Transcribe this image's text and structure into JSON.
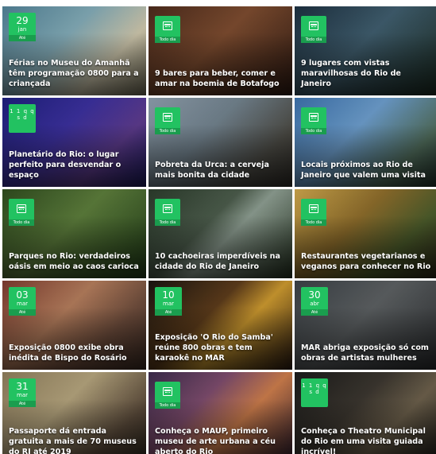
{
  "cards": [
    {
      "badge_type": "date",
      "day": "29",
      "month": "jan",
      "foot": "Até",
      "title": "Férias no Museu do Amanhã têm programação 0800 para a criançada",
      "bg": "linear-gradient(135deg,#4f7e93 0%,#7fa7b3 40%,#c9c2a8 70%,#6e6a55 100%)"
    },
    {
      "badge_type": "calendar",
      "foot": "Todo dia",
      "title": "9 bares para beber, comer e amar na boemia de Botafogo",
      "bg": "linear-gradient(135deg,#4a2a1c 0%,#7a4a2e 45%,#2e1a12 100%)"
    },
    {
      "badge_type": "calendar",
      "foot": "Todo dia",
      "title": "9 lugares com vistas maravilhosas do Rio de Janeiro",
      "bg": "linear-gradient(135deg,#1c2f3f 0%,#3e5b6b 45%,#1a2a20 100%)"
    },
    {
      "badge_type": "dots",
      "dots": "1 1 q q s d",
      "foot": "",
      "title": "Planetário do Rio: o lugar perfeito para desvendar o espaço",
      "bg": "linear-gradient(135deg,#1d1f7a 0%,#3a2f9a 40%,#5b3a8a 70%,#19195a 100%)"
    },
    {
      "badge_type": "calendar",
      "foot": "Todo dia",
      "title": "Pobreta da Urca: a cerveja mais bonita da cidade",
      "bg": "linear-gradient(135deg,#8a9aa8 0%,#6f7f8a 40%,#4b4a44 75%,#2e2b26 100%)"
    },
    {
      "badge_type": "calendar",
      "foot": "Todo dia",
      "title": "Locais próximos ao Rio de Janeiro que valem uma visita",
      "bg": "linear-gradient(135deg,#3b6fa8 0%,#6a9ac8 40%,#4f6b5a 75%,#1f2f28 100%)"
    },
    {
      "badge_type": "calendar",
      "foot": "Todo dia",
      "title": "Parques no Rio: verdadeiros oásis em meio ao caos carioca",
      "bg": "linear-gradient(135deg,#2e4a1e 0%,#5a7a3a 45%,#1f3a16 100%)"
    },
    {
      "badge_type": "calendar",
      "foot": "Todo dia",
      "title": "10 cachoeiras imperdíveis na cidade do Rio de Janeiro",
      "bg": "linear-gradient(135deg,#2a3a2a 0%,#4a5a4a 40%,#8a9a8e 55%,#23301f 100%)"
    },
    {
      "badge_type": "calendar",
      "foot": "Todo dia",
      "title": "Restaurantes vegetarianos e veganos para conhecer no Rio",
      "bg": "linear-gradient(135deg,#c8a24a 0%,#8a6a2a 40%,#4a5a2a 70%,#2a2416 100%)"
    },
    {
      "badge_type": "date",
      "day": "03",
      "month": "mar",
      "foot": "Até",
      "title": "Exposição 0800 exibe obra inédita de Bispo do Rosário",
      "bg": "linear-gradient(135deg,#7a3a2e 0%,#b07a5a 40%,#6a4a3a 70%,#3a2a22 100%)"
    },
    {
      "badge_type": "date",
      "day": "10",
      "month": "mar",
      "foot": "Até",
      "title": "Exposição 'O Rio do Samba' reúne 800 obras e tem karaokê no MAR",
      "bg": "linear-gradient(135deg,#1a1410 0%,#5a3a1a 40%,#c8962e 60%,#2a1a10 100%)"
    },
    {
      "badge_type": "date",
      "day": "30",
      "month": "abr",
      "foot": "Até",
      "title": "MAR abriga exposição só com obras de artistas mulheres",
      "bg": "linear-gradient(135deg,#3a3f44 0%,#5a5e60 45%,#2a2c2e 100%)"
    },
    {
      "badge_type": "date",
      "day": "31",
      "month": "mar",
      "foot": "Até",
      "title": "Passaporte dá entrada gratuita a mais de 70 museus do RJ até 2019",
      "bg": "linear-gradient(135deg,#8a7a5a 0%,#b0a07a 40%,#5a4a3a 75%,#2a241c 100%)"
    },
    {
      "badge_type": "calendar",
      "foot": "Todo dia",
      "title": "Conheça o MAUP, primeiro museu de arte urbana a céu aberto do Rio",
      "bg": "linear-gradient(135deg,#3a2a4a 0%,#7a4a6a 35%,#c87a4a 60%,#2a1a2a 100%)"
    },
    {
      "badge_type": "dots",
      "dots": "1 1 q q s d",
      "foot": "",
      "title": "Conheça o Theatro Municipal do Rio em uma visita guiada incrível!",
      "bg": "linear-gradient(135deg,#1a1a1a 0%,#3a352e 40%,#6a5e4a 65%,#1c1a16 100%)"
    }
  ]
}
